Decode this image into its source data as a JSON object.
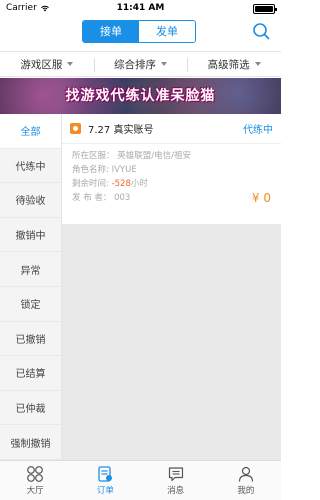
{
  "status_bar": {
    "carrier": "Carrier",
    "time": "11:41 AM"
  },
  "header": {
    "tabs": [
      {
        "label": "接单",
        "active": true
      },
      {
        "label": "发单",
        "active": false
      }
    ],
    "search_icon": "search-icon"
  },
  "filters": [
    {
      "label": "游戏区服"
    },
    {
      "label": "综合排序"
    },
    {
      "label": "高级筛选"
    }
  ],
  "banner": {
    "text": "找游戏代练认准呆脸猫"
  },
  "sidebar": {
    "items": [
      {
        "label": "全部",
        "active": true
      },
      {
        "label": "代练中"
      },
      {
        "label": "待验收"
      },
      {
        "label": "撤销中"
      },
      {
        "label": "异常"
      },
      {
        "label": "锁定"
      },
      {
        "label": "已撤销"
      },
      {
        "label": "已结算"
      },
      {
        "label": "已仲裁"
      },
      {
        "label": "强制撤销"
      }
    ]
  },
  "order": {
    "title": "7.27 真实账号",
    "status": "代练中",
    "server_label": "所在区服：",
    "server_value": "英雄联盟/电信/祖安",
    "role_label": "角色名称:",
    "role_value": "IVYUE",
    "time_label": "剩余时间:",
    "time_value": "-528",
    "time_unit": "小时",
    "publisher_label": "发 布 者：",
    "publisher_value": "003",
    "price": "¥ 0"
  },
  "tabbar": {
    "items": [
      {
        "label": "大厅",
        "icon": "grid-icon"
      },
      {
        "label": "订单",
        "icon": "order-icon",
        "active": true
      },
      {
        "label": "消息",
        "icon": "message-icon"
      },
      {
        "label": "我的",
        "icon": "profile-icon"
      }
    ]
  },
  "colors": {
    "accent": "#1a8fe6",
    "price": "#f28c28",
    "warning": "#f2662b"
  }
}
